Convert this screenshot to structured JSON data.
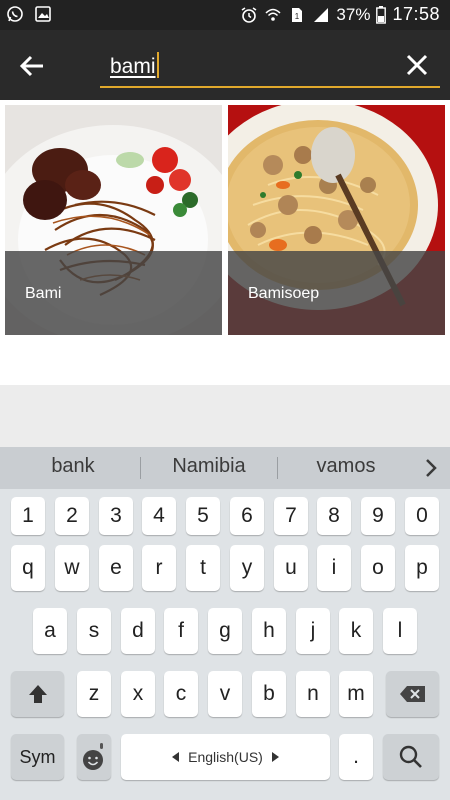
{
  "status_bar": {
    "battery": "37%",
    "time": "17:58",
    "icons": [
      "whatsapp-icon",
      "image-icon",
      "alarm-icon",
      "wifi-icon",
      "sim-icon",
      "signal-icon",
      "battery-icon"
    ]
  },
  "search": {
    "query": "bami"
  },
  "results": [
    {
      "label": "Bami"
    },
    {
      "label": "Bamisoep"
    }
  ],
  "keyboard": {
    "suggestions": [
      "bank",
      "Namibia",
      "vamos"
    ],
    "number_row": [
      "1",
      "2",
      "3",
      "4",
      "5",
      "6",
      "7",
      "8",
      "9",
      "0"
    ],
    "row1": [
      "q",
      "w",
      "e",
      "r",
      "t",
      "y",
      "u",
      "i",
      "o",
      "p"
    ],
    "row2": [
      "a",
      "s",
      "d",
      "f",
      "g",
      "h",
      "j",
      "k",
      "l"
    ],
    "row3": [
      "z",
      "x",
      "c",
      "v",
      "b",
      "n",
      "m"
    ],
    "sym_label": "Sym",
    "language": "English(US)",
    "period": "."
  },
  "colors": {
    "app_bar": "#2a2a2a",
    "accent": "#e1a92c",
    "status_bar": "#222222",
    "keyboard_bg": "#dfe3e6"
  }
}
